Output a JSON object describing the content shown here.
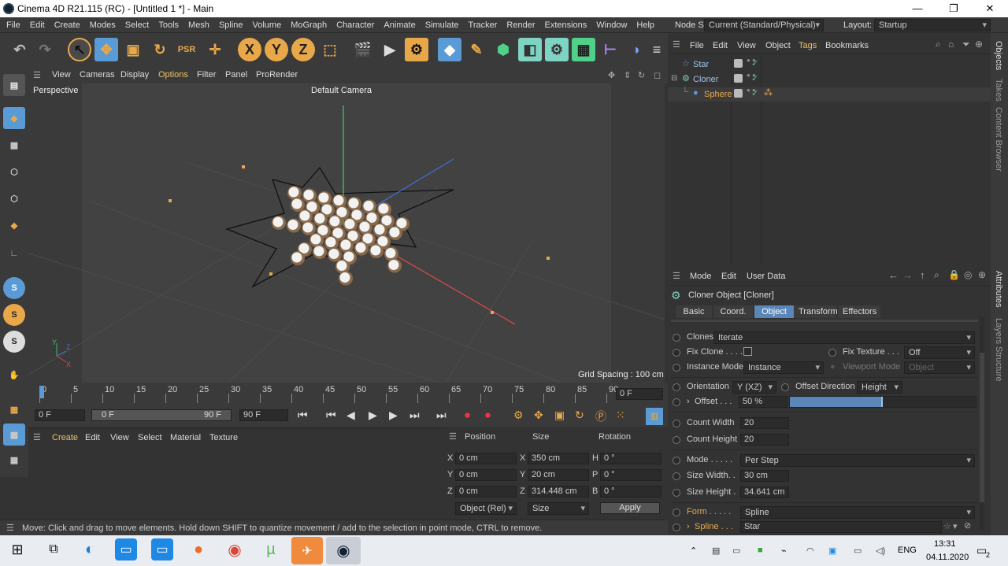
{
  "window": {
    "title": "Cinema 4D R21.115 (RC) - [Untitled 1 *] - Main",
    "minimize": "—",
    "restore": "❐",
    "close": "✕"
  },
  "menubar": {
    "items": [
      "File",
      "Edit",
      "Create",
      "Modes",
      "Select",
      "Tools",
      "Mesh",
      "Spline",
      "Volume",
      "MoGraph",
      "Character",
      "Animate",
      "Simulate",
      "Tracker",
      "Render",
      "Extensions",
      "Window",
      "Help"
    ],
    "node_space_label": "Node Space:",
    "node_space_value": "Current (Standard/Physical)",
    "layout_label": "Layout:",
    "layout_value": "Startup"
  },
  "viewport": {
    "menu": [
      "View",
      "Cameras",
      "Display",
      "Options",
      "Filter",
      "Panel",
      "ProRender"
    ],
    "name": "Perspective",
    "camera": "Default Camera",
    "grid_spacing": "Grid Spacing : 100 cm",
    "axis_y": "Y",
    "axis_z": "Z",
    "axis_x": "X"
  },
  "timeline": {
    "ticks": [
      "0",
      "5",
      "10",
      "15",
      "20",
      "25",
      "30",
      "35",
      "40",
      "45",
      "50",
      "55",
      "60",
      "65",
      "70",
      "75",
      "80",
      "85",
      "90"
    ],
    "current_frame": "0 F"
  },
  "transport": {
    "start": "0 F",
    "range_start": "0 F",
    "range_end": "90 F",
    "end": "90 F"
  },
  "material": {
    "menu": [
      "Create",
      "Edit",
      "View",
      "Select",
      "Material",
      "Texture"
    ]
  },
  "coords": {
    "headers": [
      "Position",
      "Size",
      "Rotation"
    ],
    "rows": [
      {
        "a": "X",
        "av": "0 cm",
        "b": "X",
        "bv": "350 cm",
        "c": "H",
        "cv": "0 °"
      },
      {
        "a": "Y",
        "av": "0 cm",
        "b": "Y",
        "bv": "20 cm",
        "c": "P",
        "cv": "0 °"
      },
      {
        "a": "Z",
        "av": "0 cm",
        "b": "Z",
        "bv": "314.448 cm",
        "c": "B",
        "cv": "0 °"
      }
    ],
    "mode": "Object (Rel)",
    "size_mode": "Size",
    "apply": "Apply"
  },
  "objects": {
    "menu": [
      "File",
      "Edit",
      "View",
      "Object",
      "Tags",
      "Bookmarks"
    ],
    "items": [
      {
        "name": "Star",
        "color": "#9ec1e8"
      },
      {
        "name": "Cloner",
        "color": "#9ec1e8"
      },
      {
        "name": "Sphere",
        "color": "#e8a84a"
      }
    ]
  },
  "attributes": {
    "menu": [
      "Mode",
      "Edit",
      "User Data"
    ],
    "object_title": "Cloner Object [Cloner]",
    "tabs": [
      "Basic",
      "Coord.",
      "Object",
      "Transform",
      "Effectors"
    ],
    "active_tab": "Object",
    "clones_label": "Clones",
    "clones_value": "Iterate",
    "fix_clone_label": "Fix Clone . . . .",
    "fix_texture_label": "Fix Texture . . .",
    "fix_texture_value": "Off",
    "instance_mode_label": "Instance Mode",
    "instance_mode_value": "Instance",
    "viewport_mode_label": "Viewport Mode",
    "viewport_mode_value": "Object",
    "orientation_label": "Orientation",
    "orientation_value": "Y (XZ)",
    "offset_direction_label": "Offset Direction",
    "offset_direction_value": "Height",
    "offset_label": "Offset . . .",
    "offset_value": "50 %",
    "offset_fraction": 0.5,
    "count_width_label": "Count Width",
    "count_width_value": "20",
    "count_height_label": "Count Height",
    "count_height_value": "20",
    "mode_label": "Mode . . . . .",
    "mode_value": "Per Step",
    "size_width_label": "Size Width. .",
    "size_width_value": "30 cm",
    "size_height_label": "Size Height .",
    "size_height_value": "34.641 cm",
    "form_label": "Form . . . . .",
    "form_value": "Spline",
    "spline_label": "Spline . . .",
    "spline_value": "Star"
  },
  "right_tabs": [
    "Objects",
    "Takes",
    "Content Browser",
    "Attributes",
    "Layers",
    "Structure"
  ],
  "status": "Move: Click and drag to move elements. Hold down SHIFT to quantize movement / add to the selection in point mode, CTRL to remove.",
  "taskbar": {
    "lang": "ENG",
    "time": "13:31",
    "date": "04.11.2020",
    "notif": "2"
  },
  "colors": {
    "accent": "#5b9bd5",
    "orange": "#e8a84a",
    "panel": "#333333"
  }
}
